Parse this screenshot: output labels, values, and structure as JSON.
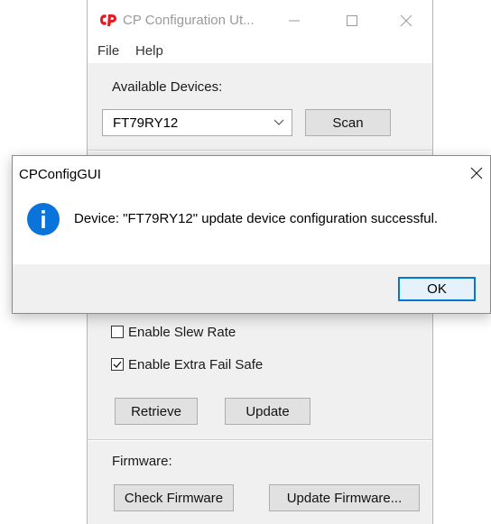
{
  "main_window": {
    "title": "CP Configuration Ut...",
    "menu": [
      "File",
      "Help"
    ],
    "available_devices_label": "Available Devices:",
    "device_select_value": "FT79RY12",
    "scan_label": "Scan",
    "options": [
      {
        "label": "Enable Slew Rate",
        "checked": false
      },
      {
        "label": "Enable Extra Fail Safe",
        "checked": true
      }
    ],
    "retrieve_label": "Retrieve",
    "update_label": "Update",
    "firmware_label": "Firmware:",
    "check_firmware_label": "Check Firmware",
    "update_firmware_label": "Update Firmware..."
  },
  "dialog": {
    "title": "CPConfigGUI",
    "message": "Device: \"FT79RY12\" update device configuration successful.",
    "ok_label": "OK",
    "icon": "info-icon"
  },
  "colors": {
    "logo_red": "#e31b23",
    "info_blue": "#0a74da",
    "default_button_border": "#0078d7"
  }
}
